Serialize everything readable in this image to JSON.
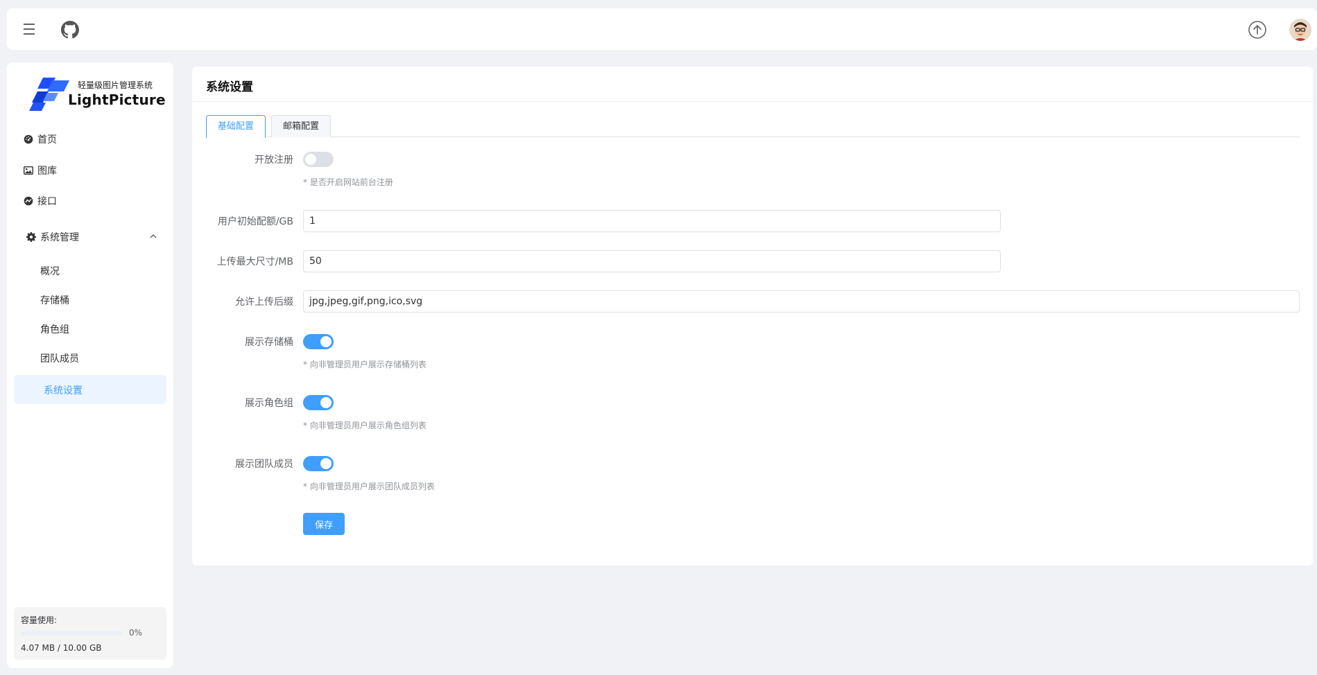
{
  "header": {
    "menu_icon": "hamburger-icon",
    "github_icon": "github-icon",
    "upload_icon": "upload-circle-icon"
  },
  "brand": {
    "tagline": "轻量级图片管理系统",
    "name": "LightPicture"
  },
  "sidebar": {
    "items": [
      {
        "label": "首页",
        "icon": "dashboard-icon"
      },
      {
        "label": "图库",
        "icon": "image-icon"
      },
      {
        "label": "接口",
        "icon": "api-icon"
      }
    ],
    "group": {
      "label": "系统管理",
      "icon": "gear-icon"
    },
    "sub_items": [
      {
        "label": "概况"
      },
      {
        "label": "存储桶"
      },
      {
        "label": "角色组"
      },
      {
        "label": "团队成员"
      },
      {
        "label": "系统设置"
      }
    ],
    "capacity": {
      "label": "容量使用:",
      "percent": "0%",
      "progress": 0,
      "used": "4.07 MB / 10.00 GB"
    }
  },
  "main": {
    "title": "系统设置",
    "tabs": [
      {
        "label": "基础配置",
        "active": true
      },
      {
        "label": "邮箱配置",
        "active": false
      }
    ],
    "form": {
      "open_register": {
        "label": "开放注册",
        "on": false,
        "hint": "* 是否开启网站前台注册"
      },
      "init_quota": {
        "label": "用户初始配额/GB",
        "value": "1"
      },
      "max_upload": {
        "label": "上传最大尺寸/MB",
        "value": "50"
      },
      "allowed_ext": {
        "label": "允许上传后缀",
        "value": "jpg,jpeg,gif,png,ico,svg"
      },
      "show_bucket": {
        "label": "展示存储桶",
        "on": true,
        "hint": "* 向非管理员用户展示存储桶列表"
      },
      "show_role": {
        "label": "展示角色组",
        "on": true,
        "hint": "* 向非管理员用户展示角色组列表"
      },
      "show_team": {
        "label": "展示团队成员",
        "on": true,
        "hint": "* 向非管理员用户展示团队成员列表"
      },
      "save_label": "保存"
    }
  },
  "colors": {
    "accent": "#409eff",
    "background": "#f0f2f5"
  }
}
